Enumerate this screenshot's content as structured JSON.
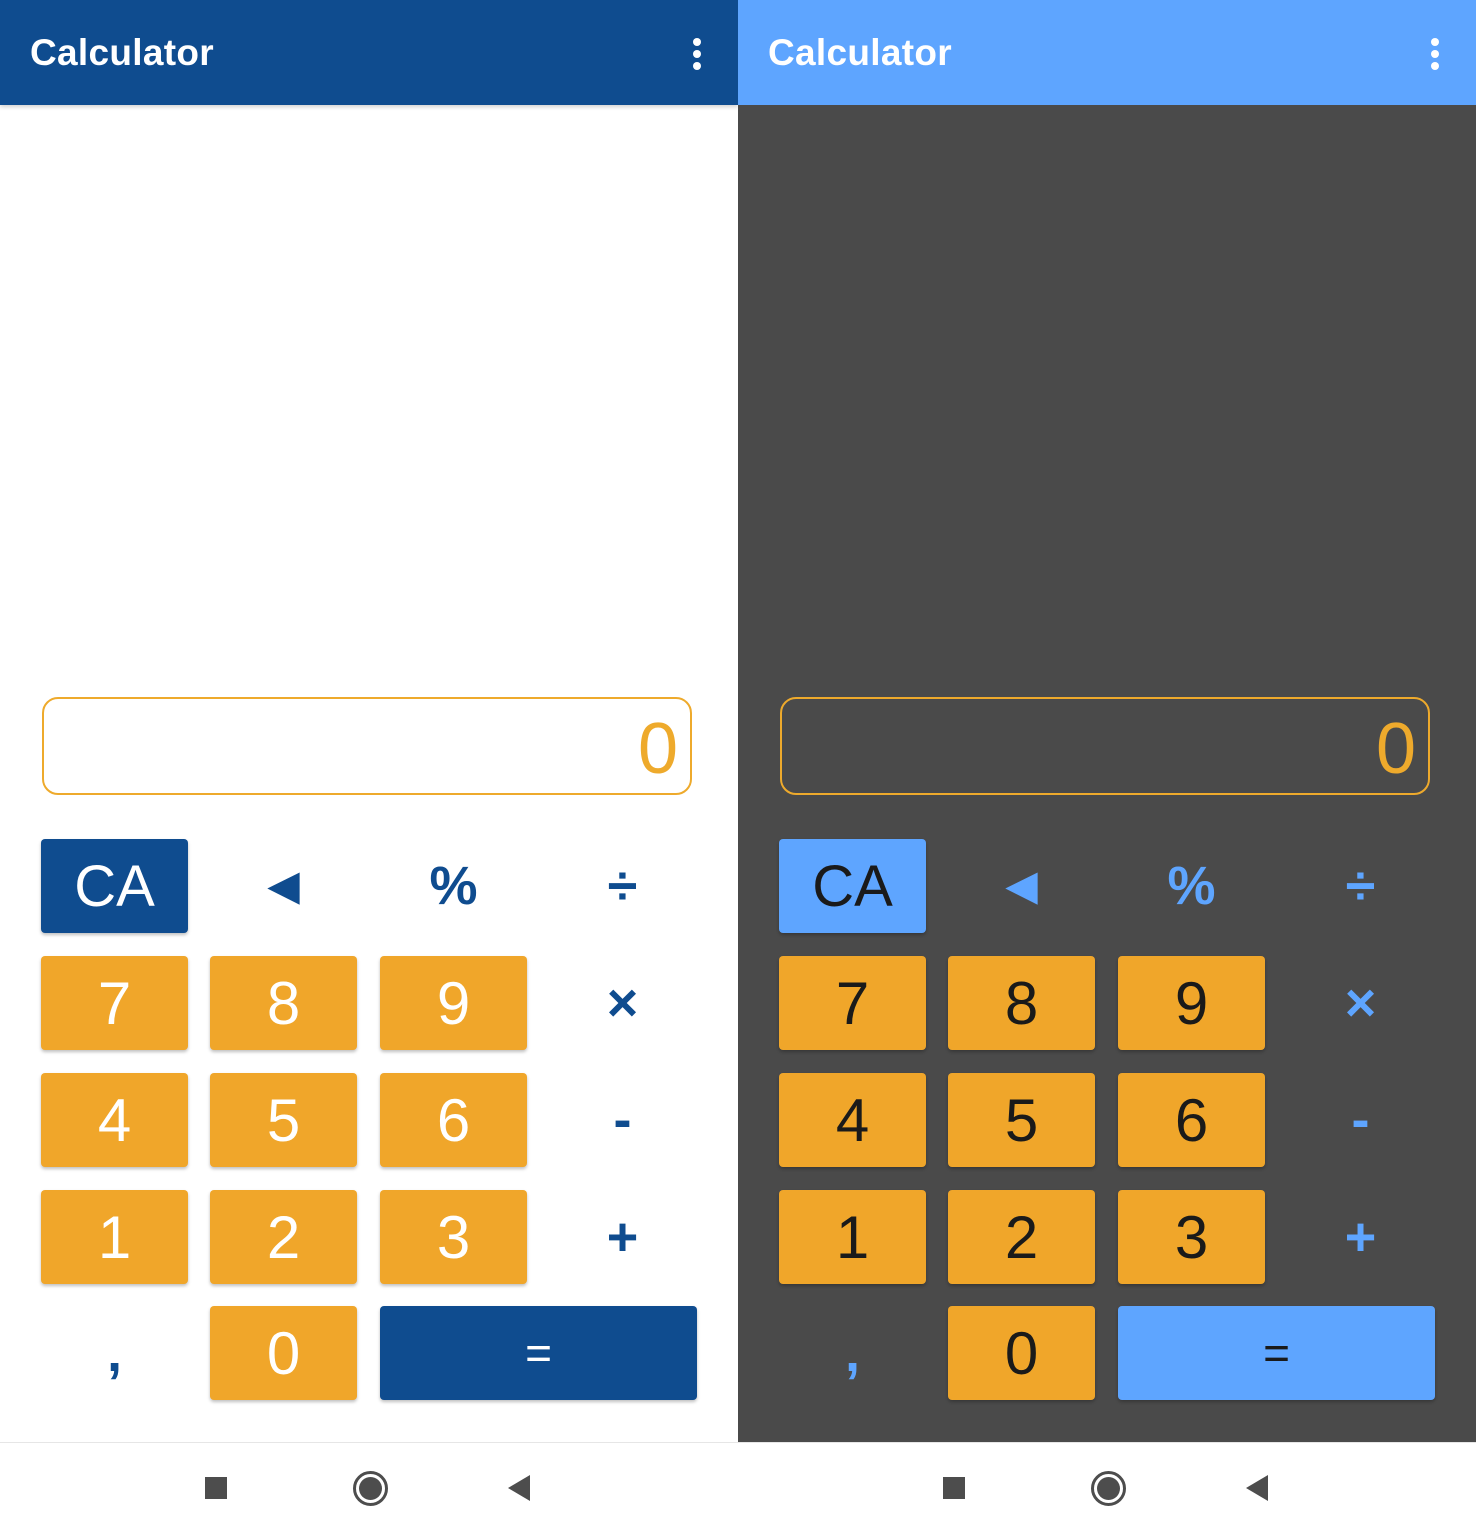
{
  "colors": {
    "light_primary": "#0f4c8f",
    "dark_primary": "#5ea5ff",
    "accent_orange": "#f0a62a",
    "dark_background": "#4a4a4a",
    "light_background": "#ffffff"
  },
  "panes": [
    {
      "theme": "light",
      "app_title": "Calculator",
      "menu_icon": "more-vertical-icon",
      "display_value": "0",
      "keys": {
        "clear": "CA",
        "backspace": "◄",
        "percent": "%",
        "divide": "÷",
        "seven": "7",
        "eight": "8",
        "nine": "9",
        "multiply": "×",
        "four": "4",
        "five": "5",
        "six": "6",
        "minus": "-",
        "one": "1",
        "two": "2",
        "three": "3",
        "plus": "+",
        "comma": ",",
        "zero": "0",
        "equals": "="
      }
    },
    {
      "theme": "dark",
      "app_title": "Calculator",
      "menu_icon": "more-vertical-icon",
      "display_value": "0",
      "keys": {
        "clear": "CA",
        "backspace": "◄",
        "percent": "%",
        "divide": "÷",
        "seven": "7",
        "eight": "8",
        "nine": "9",
        "multiply": "×",
        "four": "4",
        "five": "5",
        "six": "6",
        "minus": "-",
        "one": "1",
        "two": "2",
        "three": "3",
        "plus": "+",
        "comma": ",",
        "zero": "0",
        "equals": "="
      }
    }
  ],
  "nav_bar": {
    "icons": [
      "recents-square-icon",
      "home-circle-icon",
      "back-triangle-icon"
    ]
  }
}
